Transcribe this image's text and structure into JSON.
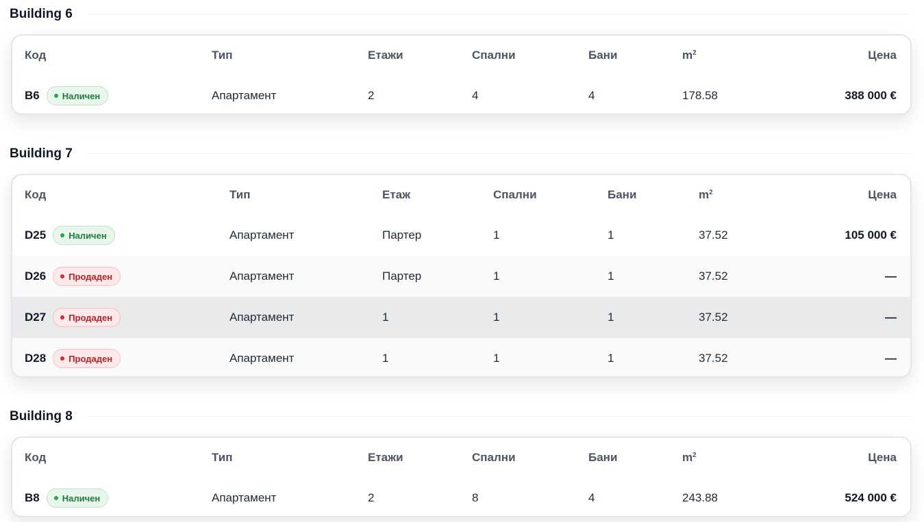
{
  "sections": [
    {
      "title": "Building 6",
      "headers": {
        "code": "Код",
        "type": "Тип",
        "floor": "Етажи",
        "bedrooms": "Спални",
        "bathrooms": "Бани",
        "area": "m",
        "area_sup": "2",
        "price": "Цена"
      },
      "rows": [
        {
          "code": "B6",
          "status": "Наличен",
          "status_kind": "available",
          "type": "Апартамент",
          "floor": "2",
          "bedrooms": "4",
          "bathrooms": "4",
          "area": "178.58",
          "price": "388 000 €"
        }
      ]
    },
    {
      "title": "Building 7",
      "headers": {
        "code": "Код",
        "type": "Тип",
        "floor": "Етаж",
        "bedrooms": "Спални",
        "bathrooms": "Бани",
        "area": "m",
        "area_sup": "2",
        "price": "Цена"
      },
      "rows": [
        {
          "code": "D25",
          "status": "Наличен",
          "status_kind": "available",
          "type": "Апартамент",
          "floor": "Партер",
          "bedrooms": "1",
          "bathrooms": "1",
          "area": "37.52",
          "price": "105 000 €"
        },
        {
          "code": "D26",
          "status": "Продаден",
          "status_kind": "sold",
          "type": "Апартамент",
          "floor": "Партер",
          "bedrooms": "1",
          "bathrooms": "1",
          "area": "37.52",
          "price": "—"
        },
        {
          "code": "D27",
          "status": "Продаден",
          "status_kind": "sold",
          "type": "Апартамент",
          "floor": "1",
          "bedrooms": "1",
          "bathrooms": "1",
          "area": "37.52",
          "price": "—"
        },
        {
          "code": "D28",
          "status": "Продаден",
          "status_kind": "sold",
          "type": "Апартамент",
          "floor": "1",
          "bedrooms": "1",
          "bathrooms": "1",
          "area": "37.52",
          "price": "—"
        }
      ]
    },
    {
      "title": "Building 8",
      "headers": {
        "code": "Код",
        "type": "Тип",
        "floor": "Етажи",
        "bedrooms": "Спални",
        "bathrooms": "Бани",
        "area": "m",
        "area_sup": "2",
        "price": "Цена"
      },
      "rows": [
        {
          "code": "B8",
          "status": "Наличен",
          "status_kind": "available",
          "type": "Апартамент",
          "floor": "2",
          "bedrooms": "8",
          "bathrooms": "4",
          "area": "243.88",
          "price": "524 000 €"
        }
      ]
    }
  ],
  "colors": {
    "available_text": "#1e7b3c",
    "available_bg": "#e8f6ec",
    "sold_text": "#b42328",
    "sold_bg": "#fde9ea",
    "hover_row_bg": "#e9eaec"
  }
}
